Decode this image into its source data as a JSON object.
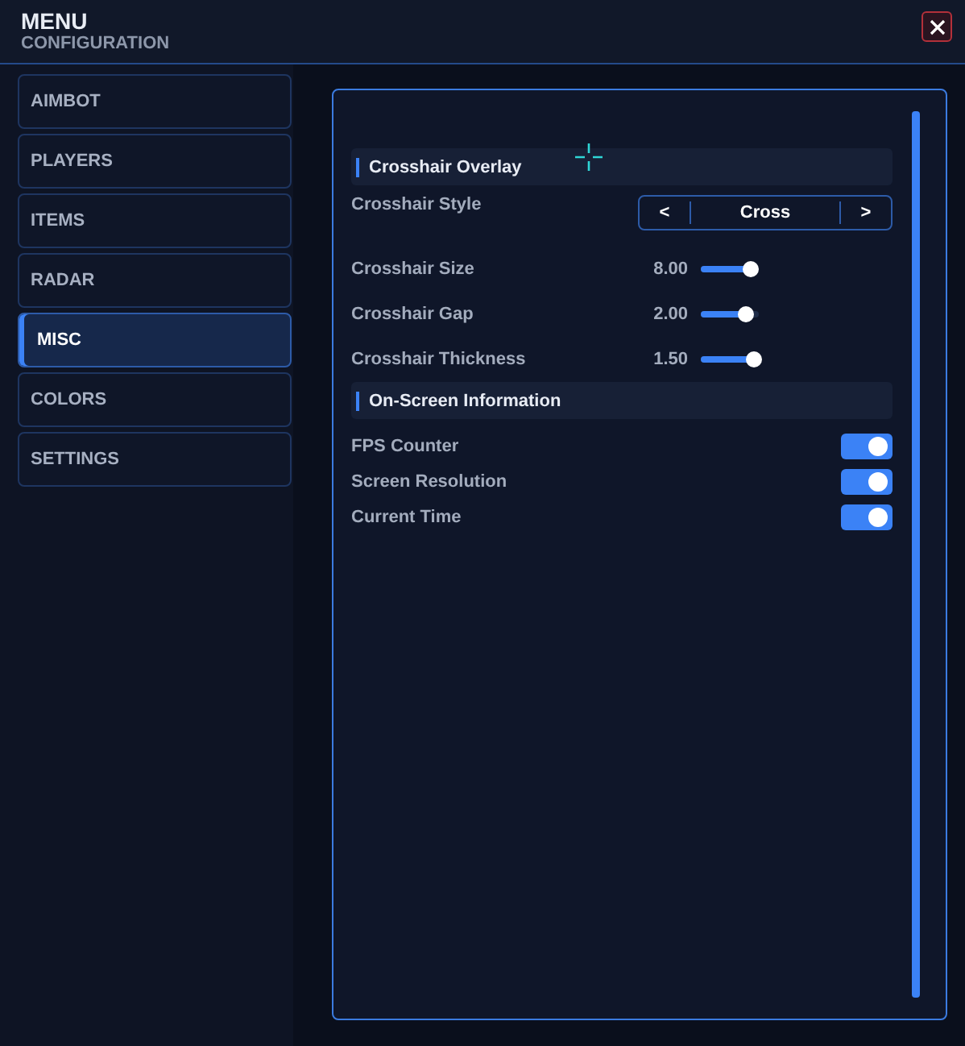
{
  "window": {
    "title": "MENU",
    "subtitle": "CONFIGURATION"
  },
  "sidebar": {
    "items": [
      {
        "label": "AIMBOT",
        "selected": false
      },
      {
        "label": "PLAYERS",
        "selected": false
      },
      {
        "label": "ITEMS",
        "selected": false
      },
      {
        "label": "RADAR",
        "selected": false
      },
      {
        "label": "MISC",
        "selected": true
      },
      {
        "label": "COLORS",
        "selected": false
      },
      {
        "label": "SETTINGS",
        "selected": false
      }
    ]
  },
  "sections": [
    {
      "title": "Crosshair Overlay",
      "rows": [
        {
          "kind": "selector",
          "label": "Crosshair Style",
          "prev": "<",
          "value": "Cross",
          "next": ">"
        },
        {
          "kind": "slider",
          "label": "Crosshair Size",
          "reading": "8.00",
          "level": 0.85
        },
        {
          "kind": "slider",
          "label": "Crosshair Gap",
          "reading": "2.00",
          "level": 0.78
        },
        {
          "kind": "slider",
          "label": "Crosshair Thickness",
          "reading": "1.50",
          "level": 0.92
        }
      ]
    },
    {
      "title": "On-Screen Information",
      "rows": [
        {
          "kind": "toggle",
          "label": "FPS Counter",
          "on": true
        },
        {
          "kind": "toggle",
          "label": "Screen Resolution",
          "on": true
        },
        {
          "kind": "toggle",
          "label": "Current Time",
          "on": true
        }
      ]
    }
  ]
}
